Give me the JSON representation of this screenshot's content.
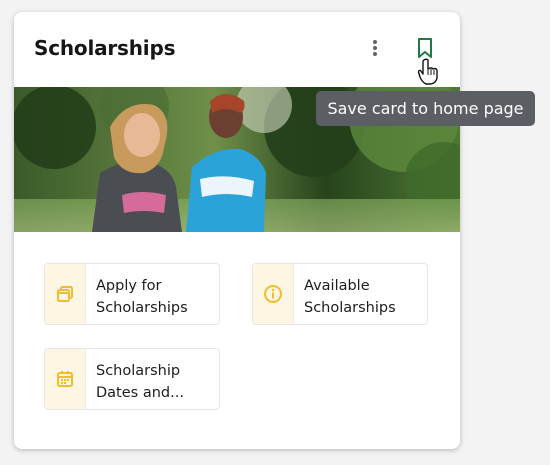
{
  "card": {
    "title": "Scholarships",
    "menu_icon": "more-vertical-icon",
    "bookmark_icon": "bookmark-icon",
    "tooltip": "Save card to home page",
    "hero_image": "photo of two students walking on campus, one wearing a Wilmington University t-shirt"
  },
  "tiles": [
    {
      "label": "Apply for Scholarships",
      "icon": "stacked-windows-icon"
    },
    {
      "label": "Available Scholarships",
      "icon": "info-icon"
    },
    {
      "label": "Scholarship Dates and...",
      "icon": "calendar-icon"
    }
  ],
  "colors": {
    "accent_green": "#1f7a45",
    "icon_gold": "#f2bd2c",
    "icon_bg": "#fdf6e2",
    "tooltip_bg": "#5b5e62"
  }
}
